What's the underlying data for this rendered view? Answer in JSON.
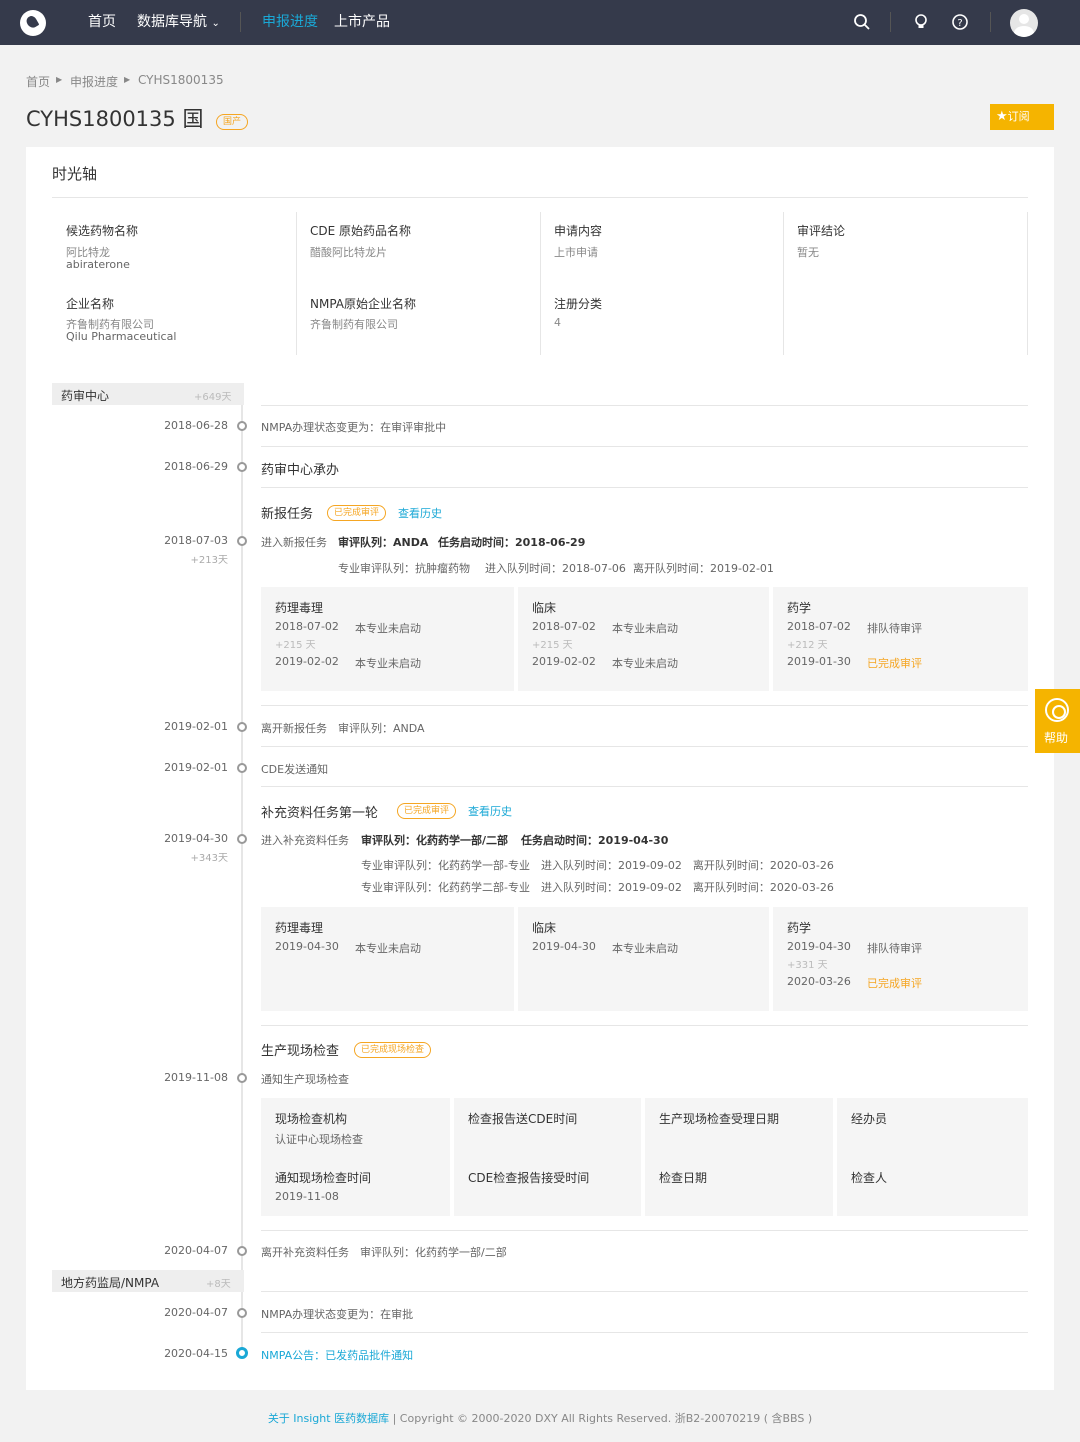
{
  "nav": {
    "home": "首页",
    "db_nav": "数据库导航",
    "progress": "申报进度",
    "market": "上市产品"
  },
  "breadcrumb": {
    "home": "首页",
    "progress": "申报进度",
    "code": "CYHS1800135"
  },
  "header": {
    "title": "CYHS1800135 国",
    "badge": "国产",
    "subscribe": "订阅"
  },
  "timeline_title": "时光轴",
  "info": [
    {
      "label": "候选药物名称",
      "value": "阿比特龙",
      "value2": "abiraterone"
    },
    {
      "label": "CDE 原始药品名称",
      "value": "醋酸阿比特龙片"
    },
    {
      "label": "申请内容",
      "value": "上市申请"
    },
    {
      "label": "审评结论",
      "value": "暂无"
    },
    {
      "label": "企业名称",
      "value": "齐鲁制药有限公司",
      "value2": "Qilu Pharmaceutical"
    },
    {
      "label": "NMPA原始企业名称",
      "value": "齐鲁制药有限公司"
    },
    {
      "label": "注册分类",
      "value": "4"
    }
  ],
  "phases": {
    "cde": {
      "name": "药审中心",
      "days": "+649天"
    },
    "local": {
      "name": "地方药监局/NMPA",
      "days": "+8天"
    }
  },
  "events": {
    "e1": {
      "date": "2018-06-28",
      "text": "NMPA办理状态变更为：在审评审批中"
    },
    "e2": {
      "date": "2018-06-29",
      "text": "药审中心承办"
    },
    "task1": {
      "title": "新报任务",
      "status": "已完成审评",
      "history": "查看历史",
      "date": "2018-07-03",
      "days": "+213天",
      "enter": "进入新报任务",
      "queue": "审评队列：ANDA",
      "start": "任务启动时间：2018-06-29",
      "spec": "专业审评队列：抗肿瘤药物",
      "in": "进入队列时间：2018-07-06",
      "out": "离开队列时间：2019-02-01"
    },
    "e3": {
      "date": "2019-02-01",
      "text": "离开新报任务　审评队列：ANDA"
    },
    "e4": {
      "date": "2019-02-01",
      "text": "CDE发送通知"
    },
    "task2": {
      "title": "补充资料任务第一轮",
      "status": "已完成审评",
      "history": "查看历史",
      "date": "2019-04-30",
      "days": "+343天",
      "enter": "进入补充资料任务",
      "queue": "审评队列：化药药学一部/二部",
      "start": "任务启动时间：2019-04-30",
      "l1": "专业审评队列：化药药学一部-专业　进入队列时间：2019-09-02　离开队列时间：2020-03-26",
      "l2": "专业审评队列：化药药学二部-专业　进入队列时间：2019-09-02　离开队列时间：2020-03-26"
    },
    "insp": {
      "title": "生产现场检查",
      "status": "已完成现场检查",
      "date": "2019-11-08",
      "text": "通知生产现场检查"
    },
    "e5": {
      "date": "2020-04-07",
      "text": "离开补充资料任务　审评队列：化药药学一部/二部"
    },
    "e6": {
      "date": "2020-04-07",
      "text": "NMPA办理状态变更为：在审批"
    },
    "e7": {
      "date": "2020-04-15",
      "text": "NMPA公告：已发药品批件通知"
    }
  },
  "review1": [
    {
      "name": "药理毒理",
      "d1": "2018-07-02",
      "s1": "本专业未启动",
      "diff": "+215 天",
      "d2": "2019-02-02",
      "s2": "本专业未启动"
    },
    {
      "name": "临床",
      "d1": "2018-07-02",
      "s1": "本专业未启动",
      "diff": "+215 天",
      "d2": "2019-02-02",
      "s2": "本专业未启动"
    },
    {
      "name": "药学",
      "d1": "2018-07-02",
      "s1": "排队待审评",
      "diff": "+212 天",
      "d2": "2019-01-30",
      "s2": "已完成审评"
    }
  ],
  "review2": [
    {
      "name": "药理毒理",
      "d1": "2019-04-30",
      "s1": "本专业未启动"
    },
    {
      "name": "临床",
      "d1": "2019-04-30",
      "s1": "本专业未启动"
    },
    {
      "name": "药学",
      "d1": "2019-04-30",
      "s1": "排队待审评",
      "diff": "+331 天",
      "d2": "2020-03-26",
      "s2": "已完成审评"
    }
  ],
  "inspection": {
    "org": "现场检查机构",
    "org_val": "认证中心现场检查",
    "report_sent": "检查报告送CDE时间",
    "accept_date": "生产现场检查受理日期",
    "handler": "经办员",
    "notify_time": "通知现场检查时间",
    "notify_val": "2019-11-08",
    "cde_recv": "CDE检查报告接受时间",
    "insp_date": "检查日期",
    "inspector": "检查人"
  },
  "help": "帮助",
  "footer": {
    "link": "关于 Insight 医药数据库",
    "rest": "  |  Copyright © 2000-2020 DXY All Rights Reserved. 浙B2-20070219 ( 含BBS )"
  }
}
